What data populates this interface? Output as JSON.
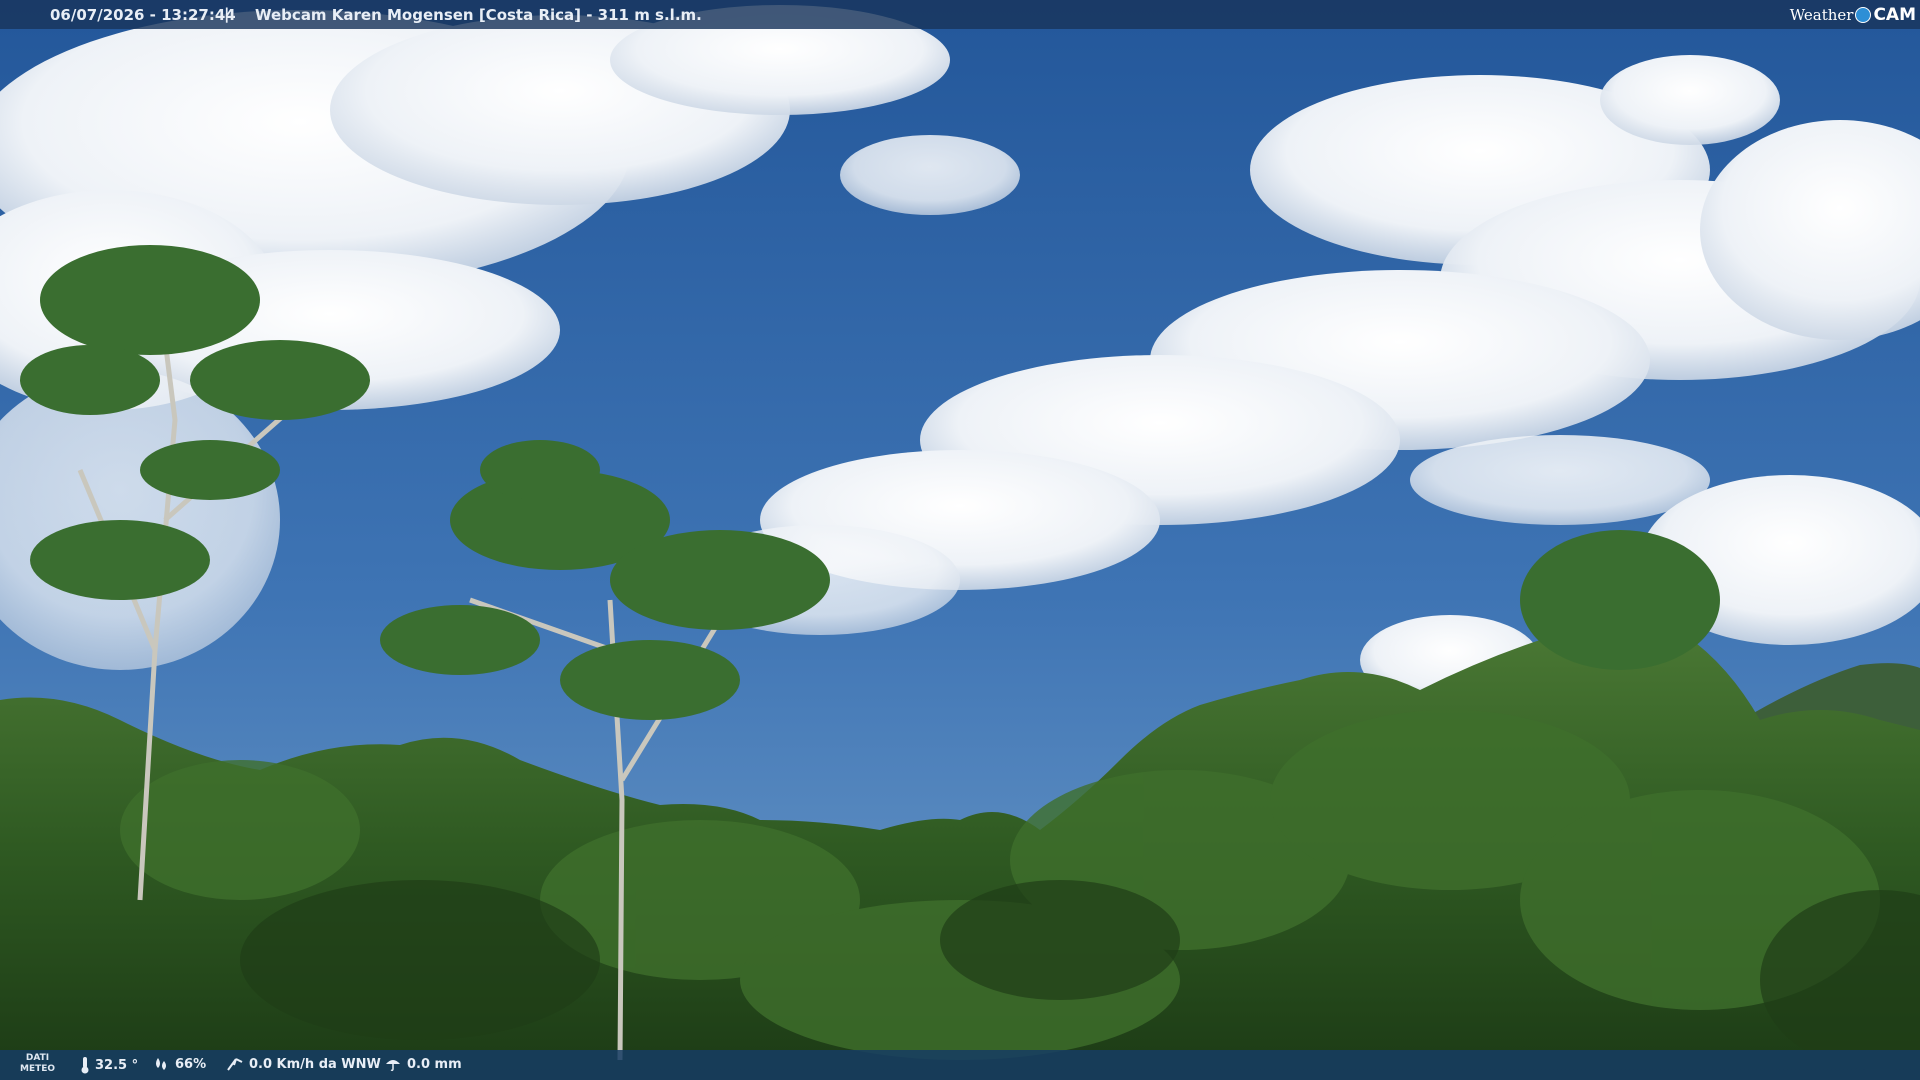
{
  "header": {
    "timestamp": "06/07/2026 - 13:27:44",
    "separator": "|",
    "location": "Webcam Karen Mogensen [Costa Rica]  - 311 m s.l.m.",
    "logo_text": "Weather",
    "logo_cam": "CAM"
  },
  "footer": {
    "label_line1": "DATI",
    "label_line2": "METEO",
    "temperature": "32.5 °",
    "humidity": "66%",
    "wind": "0.0 Km/h da WNW",
    "rain": "0.0 mm",
    "icons": [
      "thermometer-icon",
      "humidity-icon",
      "wind-icon",
      "rain-icon"
    ]
  },
  "colors": {
    "sky_top": "#23579a",
    "sky_bottom": "#5a8cc4",
    "forest": "#2f5a22",
    "bar": "#18345c"
  }
}
